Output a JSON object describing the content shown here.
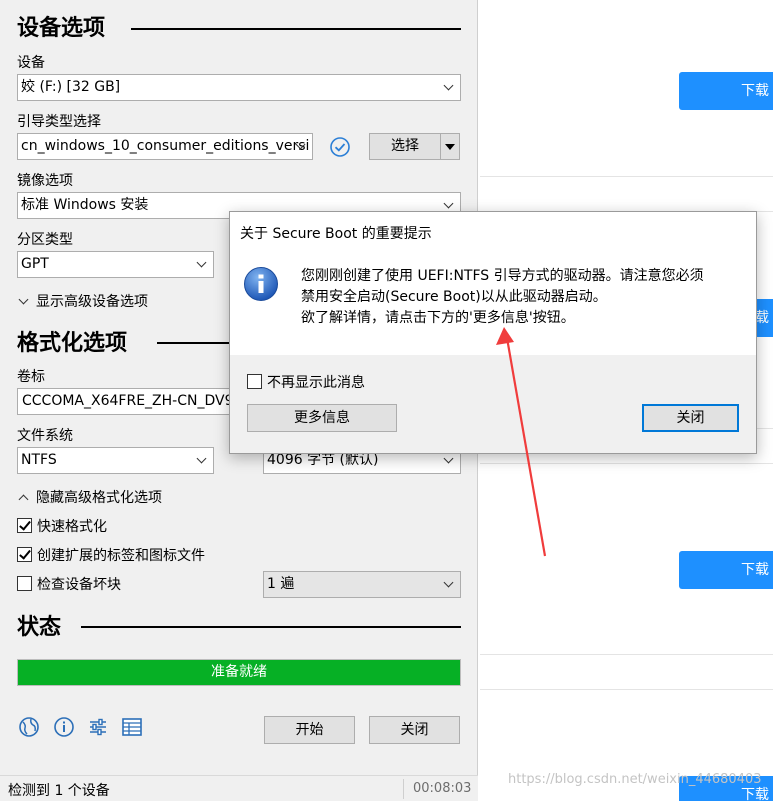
{
  "background_page": {
    "buttons": [
      "下载",
      "下载",
      "下载",
      "下载",
      "下载"
    ],
    "watermark": "https://blog.csdn.net/weixin_44680403"
  },
  "app": {
    "device_section": {
      "title": "设备选项",
      "device_label": "设备",
      "device_value": "姣 (F:) [32 GB]",
      "boot_label": "引导类型选择",
      "boot_value": "cn_windows_10_consumer_editions_versi",
      "select_button": "选择",
      "image_label": "镜像选项",
      "image_value": "标准 Windows 安装",
      "partition_label": "分区类型",
      "partition_value": "GPT",
      "advanced_toggle": "显示高级设备选项"
    },
    "format_section": {
      "title": "格式化选项",
      "volume_label": "卷标",
      "volume_value": "CCCOMA_X64FRE_ZH-CN_DV9",
      "fs_label": "文件系统",
      "fs_value": "NTFS",
      "cluster_value": "4096 字节 (默认)",
      "advanced_toggle": "隐藏高级格式化选项",
      "quick_format": "快速格式化",
      "quick_format_checked": true,
      "extended_label": "创建扩展的标签和图标文件",
      "extended_label_checked": true,
      "bad_blocks": "检查设备坏块",
      "bad_blocks_checked": false,
      "passes_value": "1 遍"
    },
    "status_section": {
      "title": "状态",
      "progress_text": "准备就绪",
      "progress_percent": 100,
      "progress_color": "#06b025"
    },
    "toolbar": {
      "icons": [
        "globe-icon",
        "info-icon",
        "settings-sliders-icon",
        "log-table-icon"
      ],
      "start_button": "开始",
      "close_button": "关闭"
    },
    "statusbar": {
      "text": "检测到 1 个设备",
      "timer": "00:08:03"
    }
  },
  "dialog": {
    "title": "关于 Secure Boot 的重要提示",
    "icon": "info-icon",
    "message_lines": [
      "您刚刚创建了使用 UEFI:NTFS 引导方式的驱动器。请注意您必须",
      "禁用安全启动(Secure Boot)以从此驱动器启动。",
      "欲了解详情，请点击下方的'更多信息'按钮。"
    ],
    "dont_show_label": "不再显示此消息",
    "dont_show_checked": false,
    "more_info_button": "更多信息",
    "close_button": "关闭"
  },
  "accent_colors": {
    "download_button": "#1e90ff",
    "annotation_arrow": "#f03c3c"
  }
}
